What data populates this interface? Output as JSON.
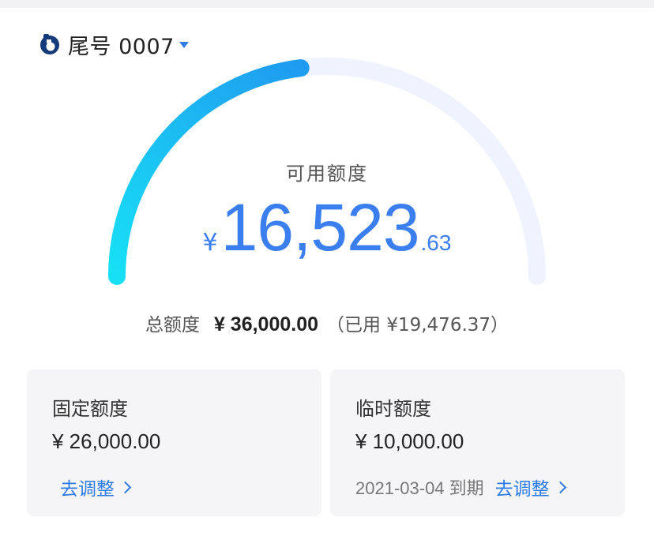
{
  "account": {
    "icon": "bank-logo-icon",
    "label": "尾号 0007",
    "brand_color": "#153a7a",
    "caret_color": "#2f7be6"
  },
  "gauge": {
    "used_fraction": 0.46,
    "track_color": "#eef3fd",
    "fill_start": "#17e0f5",
    "fill_end": "#1f9bf0"
  },
  "available": {
    "label": "可用额度",
    "currency": "¥",
    "integer": "16,523",
    "decimal": ".63",
    "color": "#3a7ef0"
  },
  "total": {
    "label": "总额度",
    "value": "¥ 36,000.00",
    "used": "（已用 ¥19,476.37）"
  },
  "cards": {
    "fixed": {
      "title": "固定额度",
      "amount": "¥ 26,000.00",
      "link": "去调整"
    },
    "temp": {
      "title": "临时额度",
      "amount": "¥ 10,000.00",
      "expire": "2021-03-04 到期",
      "link": "去调整"
    }
  },
  "link_color": "#2f7be6"
}
